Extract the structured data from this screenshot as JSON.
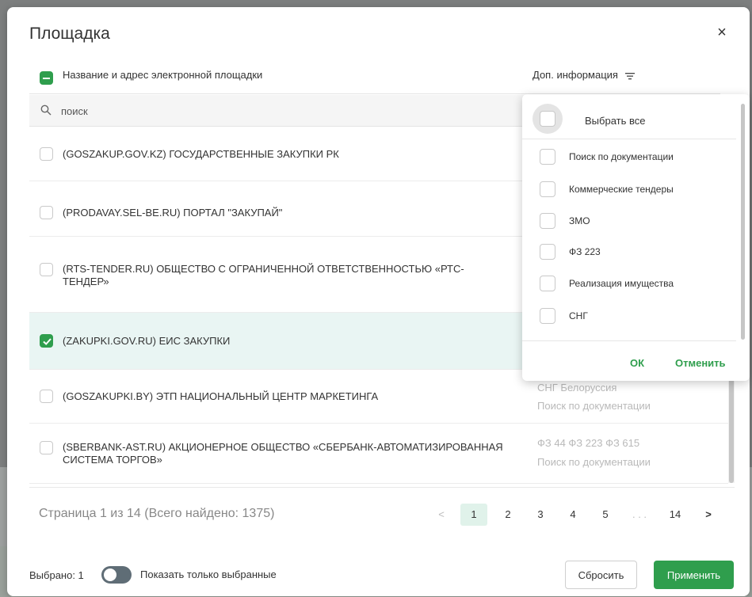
{
  "modal": {
    "title": "Площадка"
  },
  "table": {
    "header": {
      "name_label": "Название и адрес электронной площадки",
      "info_label": "Доп. информация"
    },
    "search": {
      "placeholder": "поиск"
    },
    "rows": [
      {
        "name": "(GOSZAKUP.GOV.KZ) ГОСУДАРСТВЕННЫЕ ЗАКУПКИ РК",
        "checked": false,
        "tags1": "",
        "tags2": ""
      },
      {
        "name": "(PRODAVAY.SEL-BE.RU) ПОРТАЛ \"ЗАКУПАЙ\"",
        "checked": false,
        "tags1": "",
        "tags2": ""
      },
      {
        "name": "(RTS-TENDER.RU) ОБЩЕСТВО С ОГРАНИЧЕННОЙ ОТВЕТСТВЕННОСТЬЮ «РТС-ТЕНДЕР»",
        "checked": false,
        "tags1": "",
        "tags2": ""
      },
      {
        "name": "(ZAKUPKI.GOV.RU) ЕИС ЗАКУПКИ",
        "checked": true,
        "tags1": "",
        "tags2": ""
      },
      {
        "name": "(GOSZAKUPKI.BY) ЭТП НАЦИОНАЛЬНЫЙ ЦЕНТР МАРКЕТИНГА",
        "checked": false,
        "tags1": "СНГ  Белоруссия",
        "tags2": "Поиск по документации"
      },
      {
        "name": "(SBERBANK-AST.RU) АКЦИОНЕРНОЕ ОБЩЕСТВО «СБЕРБАНК-АВТОМАТИЗИРОВАННАЯ СИСТЕМА ТОРГОВ»",
        "checked": false,
        "tags1": "ФЗ 44   ФЗ 223   ФЗ 615",
        "tags2": "Поиск по документации"
      }
    ]
  },
  "pagination": {
    "info": "Страница 1 из 14 (Всего найдено: 1375)",
    "prev": "<",
    "pages": [
      "1",
      "2",
      "3",
      "4",
      "5",
      ". . .",
      "14"
    ],
    "next": ">"
  },
  "footer": {
    "selected_count": "Выбрано: 1",
    "toggle_label": "Показать только выбранные",
    "reset_label": "Сбросить",
    "apply_label": "Применить"
  },
  "dropdown": {
    "select_all": "Выбрать все",
    "items": [
      "Поиск по документации",
      "Коммерческие тендеры",
      "ЗМО",
      "ФЗ 223",
      "Реализация имущества",
      "СНГ"
    ],
    "ok_label": "ОК",
    "cancel_label": "Отменить"
  },
  "colors": {
    "accent": "#2f9e4d",
    "selected_row": "#e9f5f3"
  }
}
